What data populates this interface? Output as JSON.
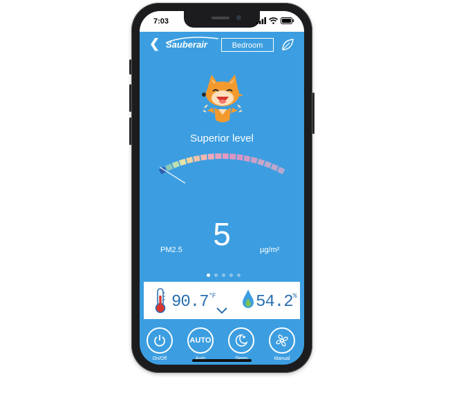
{
  "status_bar": {
    "time": "7:03"
  },
  "header": {
    "brand": "Sauberair",
    "room": "Bedroom"
  },
  "air": {
    "level_text": "Superior level",
    "pm_label": "PM2.5",
    "pm_value": "5",
    "pm_unit": "µg/m²"
  },
  "gauge": {
    "needle_fraction": 0.02
  },
  "pager": {
    "count": 5,
    "active": 0
  },
  "sensors": {
    "temperature": "90.7",
    "temperature_unit": "°F",
    "humidity": "54.2",
    "humidity_unit": "%"
  },
  "controls": [
    {
      "label": "On/Off",
      "icon": "power-icon"
    },
    {
      "label": "Auto",
      "icon": "auto-icon",
      "text": "AUTO"
    },
    {
      "label": "Sleep",
      "icon": "moon-icon"
    },
    {
      "label": "Manual",
      "icon": "fan-icon"
    }
  ],
  "colors": {
    "background": "#3c9ee0",
    "panel": "#ffffff",
    "accent_text": "#2a6fb0"
  }
}
